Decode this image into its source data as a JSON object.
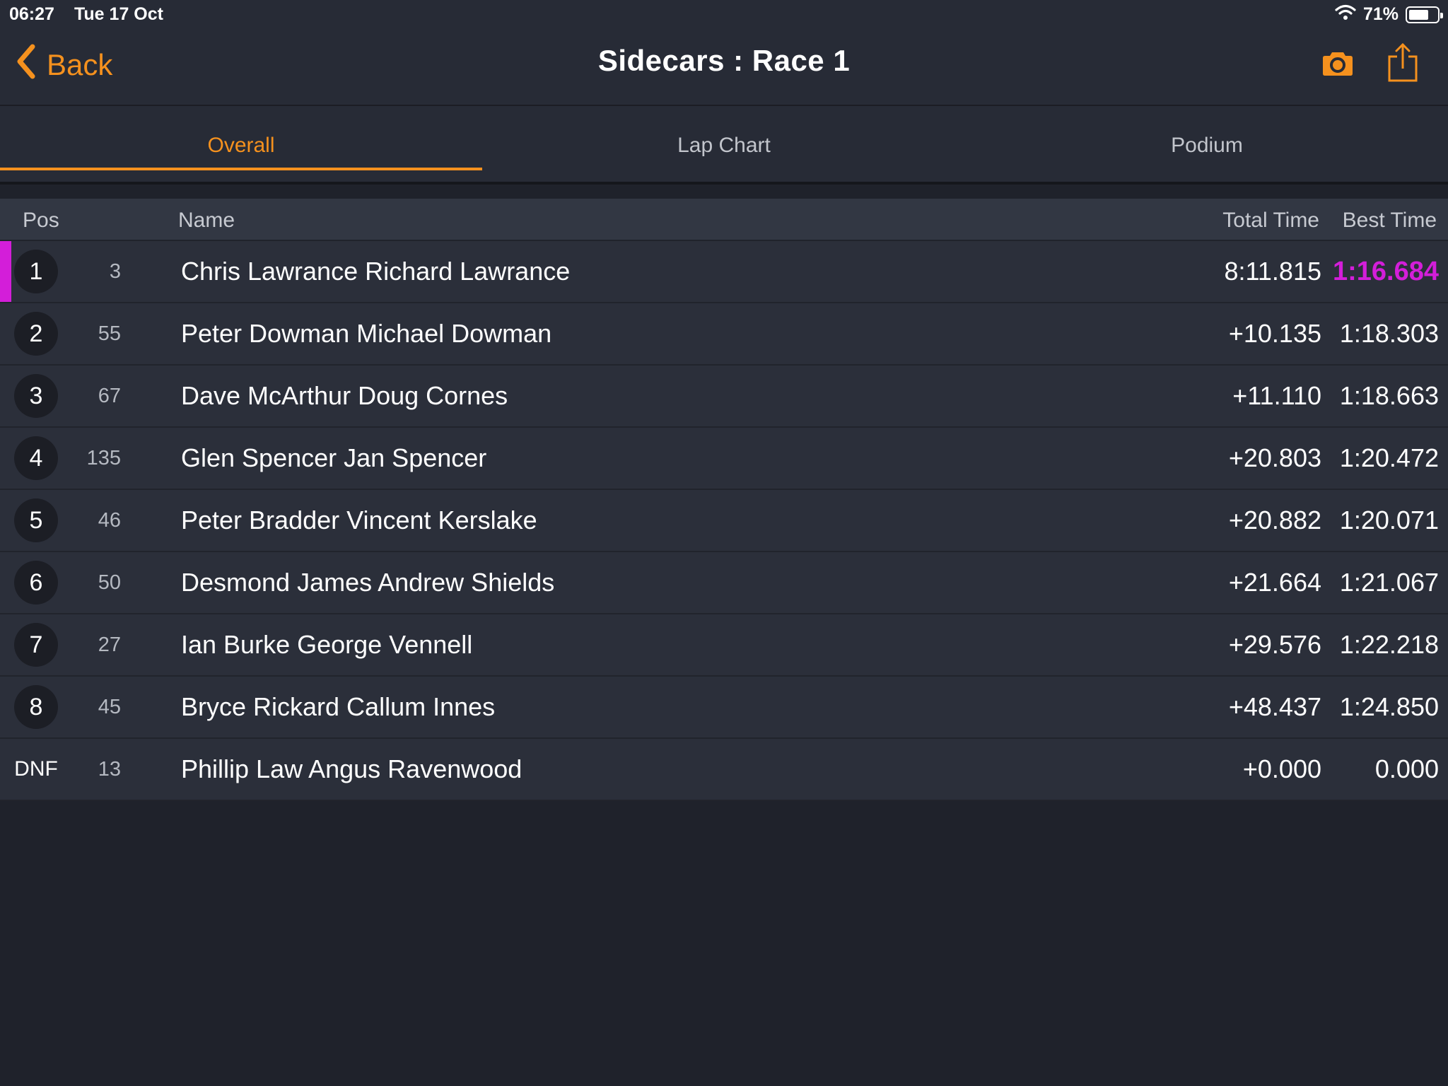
{
  "status_bar": {
    "time": "06:27",
    "date": "Tue 17 Oct",
    "battery": "71%",
    "battery_level": 0.71,
    "icons": [
      "wifi-icon",
      "battery-icon"
    ]
  },
  "nav": {
    "back_label": "Back",
    "title": "Sidecars : Race 1",
    "icons": [
      "chevron-left-icon",
      "camera-icon",
      "share-icon"
    ]
  },
  "tabs": [
    {
      "label": "Overall",
      "active": true
    },
    {
      "label": "Lap Chart",
      "active": false
    },
    {
      "label": "Podium",
      "active": false
    }
  ],
  "table": {
    "headers": {
      "pos": "Pos",
      "name": "Name",
      "total_time": "Total Time",
      "best_time": "Best Time"
    },
    "rows": [
      {
        "pos": "1",
        "number": "3",
        "name": "Chris Lawrance Richard Lawrance",
        "total": "8:11.815",
        "best": "1:16.684",
        "fastest": true
      },
      {
        "pos": "2",
        "number": "55",
        "name": "Peter Dowman Michael Dowman",
        "total": "+10.135",
        "best": "1:18.303"
      },
      {
        "pos": "3",
        "number": "67",
        "name": "Dave McArthur Doug Cornes",
        "total": "+11.110",
        "best": "1:18.663"
      },
      {
        "pos": "4",
        "number": "135",
        "name": "Glen Spencer Jan Spencer",
        "total": "+20.803",
        "best": "1:20.472"
      },
      {
        "pos": "5",
        "number": "46",
        "name": "Peter Bradder Vincent Kerslake",
        "total": "+20.882",
        "best": "1:20.071"
      },
      {
        "pos": "6",
        "number": "50",
        "name": "Desmond James Andrew Shields",
        "total": "+21.664",
        "best": "1:21.067"
      },
      {
        "pos": "7",
        "number": "27",
        "name": "Ian Burke George Vennell",
        "total": "+29.576",
        "best": "1:22.218"
      },
      {
        "pos": "8",
        "number": "45",
        "name": "Bryce Rickard Callum Innes",
        "total": "+48.437",
        "best": "1:24.850"
      },
      {
        "pos": "DNF",
        "number": "13",
        "name": "Phillip Law Angus Ravenwood",
        "total": "+0.000",
        "best": "0.000"
      }
    ]
  },
  "colors": {
    "accent": "#f5911e",
    "fastest_lap": "#d31ed9",
    "background": "#1f222b",
    "row": "#2b2f3a"
  }
}
